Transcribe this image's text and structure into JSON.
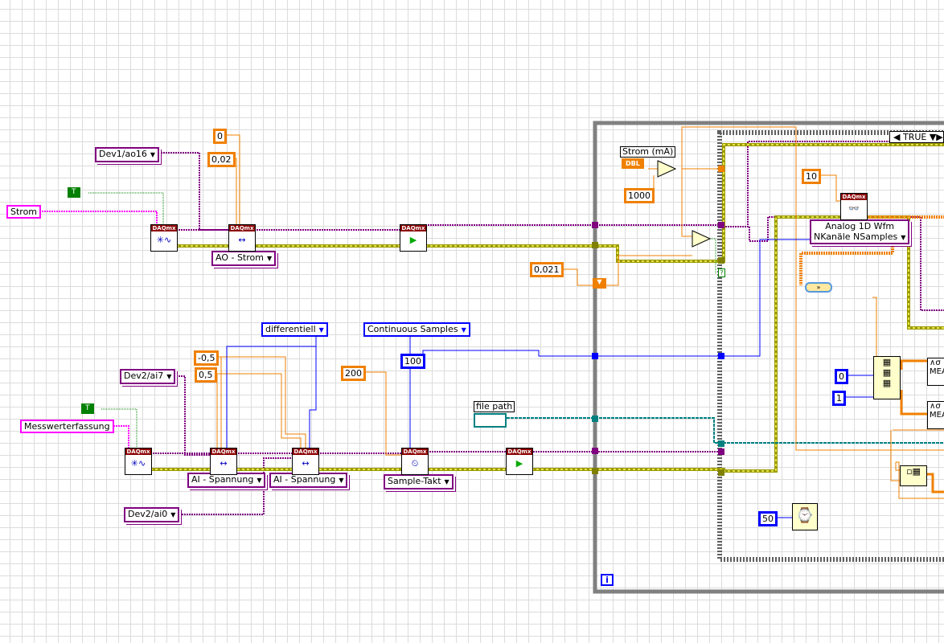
{
  "controls": {
    "strom": "Strom",
    "messwert": "Messwerterfassung",
    "bool_true_1": "T",
    "bool_true_2": "T",
    "file_path": "file path",
    "strom_ma": "Strom (mA)",
    "dbl": "DBL"
  },
  "channels": {
    "ao": "Dev1/ao16",
    "ai7": "Dev2/ai7",
    "ai0": "Dev2/ai0"
  },
  "constants": {
    "min_ao": "0",
    "max_ao": "0,02",
    "neg05": "-0,5",
    "pos05": "0,5",
    "rate": "200",
    "samples": "100",
    "compare": "0,021",
    "divisor": "1000",
    "read_n": "10",
    "idx0": "0",
    "idx1": "1",
    "wait_ms": "50"
  },
  "rings": {
    "ao_strom": "AO - Strom",
    "ai_sp1": "AI - Spannung",
    "ai_sp2": "AI - Spannung",
    "sample_takt": "Sample-Takt",
    "differentiell": "differentiell",
    "continuous": "Continuous Samples",
    "read_mode_1": "Analog 1D Wfm",
    "read_mode_2": "NKanäle NSamples"
  },
  "daqmx_label": "DAQmx",
  "case_selector": "TRUE",
  "loop_iteration": "i",
  "measure_labels": [
    "MEA",
    "MEA"
  ],
  "colors": {
    "numeric": "#f08000",
    "integer": "#0000ff",
    "task": "#800080",
    "error": "#c8c800",
    "string": "#ff00ff",
    "boolean": "#008000",
    "path": "#008080"
  }
}
